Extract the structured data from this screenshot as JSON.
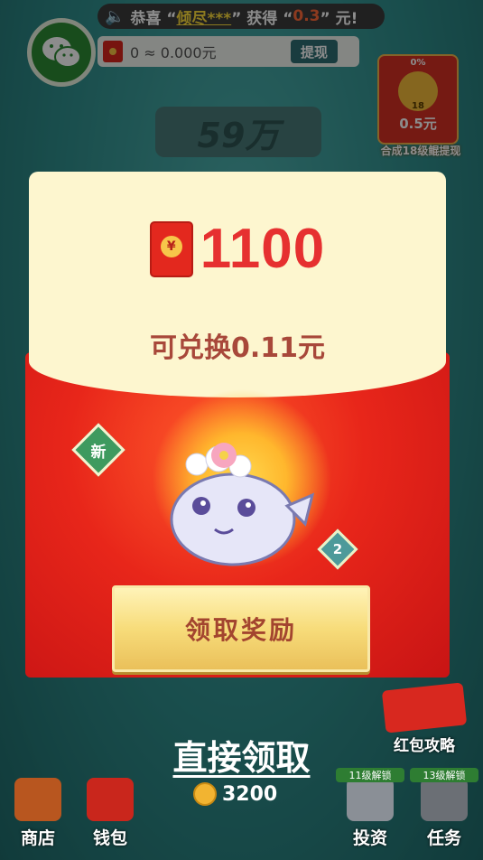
{
  "top_bar": {
    "broadcast_prefix": "恭喜 “",
    "broadcast_user": "倾尽***",
    "broadcast_mid": "” 获得 “",
    "broadcast_amount": "0.3",
    "broadcast_suffix": "” 元!"
  },
  "balance": {
    "text": "0 ≈ 0.000元",
    "withdraw_label": "提现"
  },
  "side_reward": {
    "progress": "0%",
    "level": "18",
    "value": "0.5元",
    "caption": "合成18级鲲提现"
  },
  "score": {
    "value": "59万"
  },
  "modal": {
    "amount": "1100",
    "red_packet_symbol": "¥",
    "exchange_text": "可兑换0.11元",
    "badge_new": "新",
    "badge_level": "2",
    "claim_button": "领取奖励"
  },
  "direct_claim": "直接领取",
  "coins": {
    "total": "3200"
  },
  "bottom_nav": {
    "shop": "商店",
    "wallet": "钱包",
    "invest": "投资",
    "invest_lock": "11级解锁",
    "tasks": "任务",
    "tasks_lock": "13级解锁",
    "strategy": "红包攻略"
  },
  "colors": {
    "accent_red": "#e63030",
    "cream": "#fdf6cf",
    "gold": "#f7dc7a"
  }
}
